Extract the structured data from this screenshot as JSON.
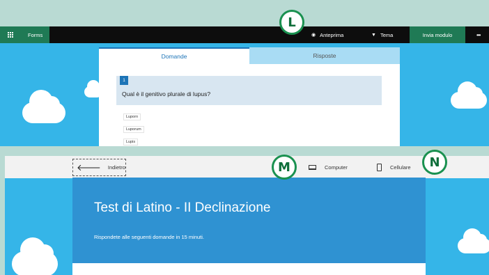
{
  "top_panel": {
    "app_name": "Forms",
    "toolbar": {
      "preview_label": "Anteprima",
      "theme_label": "Tema",
      "send_label": "Invia modulo",
      "more_label": "•••"
    },
    "tabs": [
      {
        "label": "Domande",
        "active": true
      },
      {
        "label": "Risposte",
        "active": false
      }
    ],
    "question": {
      "number": "1",
      "text": "Qual è il genitivo plurale di lupus?",
      "options": [
        "Luporn",
        "Luporum",
        "Lupis"
      ]
    }
  },
  "bottom_panel": {
    "back_label": "Indietro",
    "computer_label": "Computer",
    "mobile_label": "Cellulare",
    "form_title": "Test di Latino - II Declinazione",
    "form_description": "Rispondete alle seguenti domande in 15 minuti."
  },
  "callouts": {
    "l": "L",
    "m": "M",
    "n": "N"
  },
  "colors": {
    "sky": "#35b5e8",
    "accent_green": "#1f7a55",
    "header_blue": "#2f92d2",
    "badge_border": "#1a9150"
  }
}
